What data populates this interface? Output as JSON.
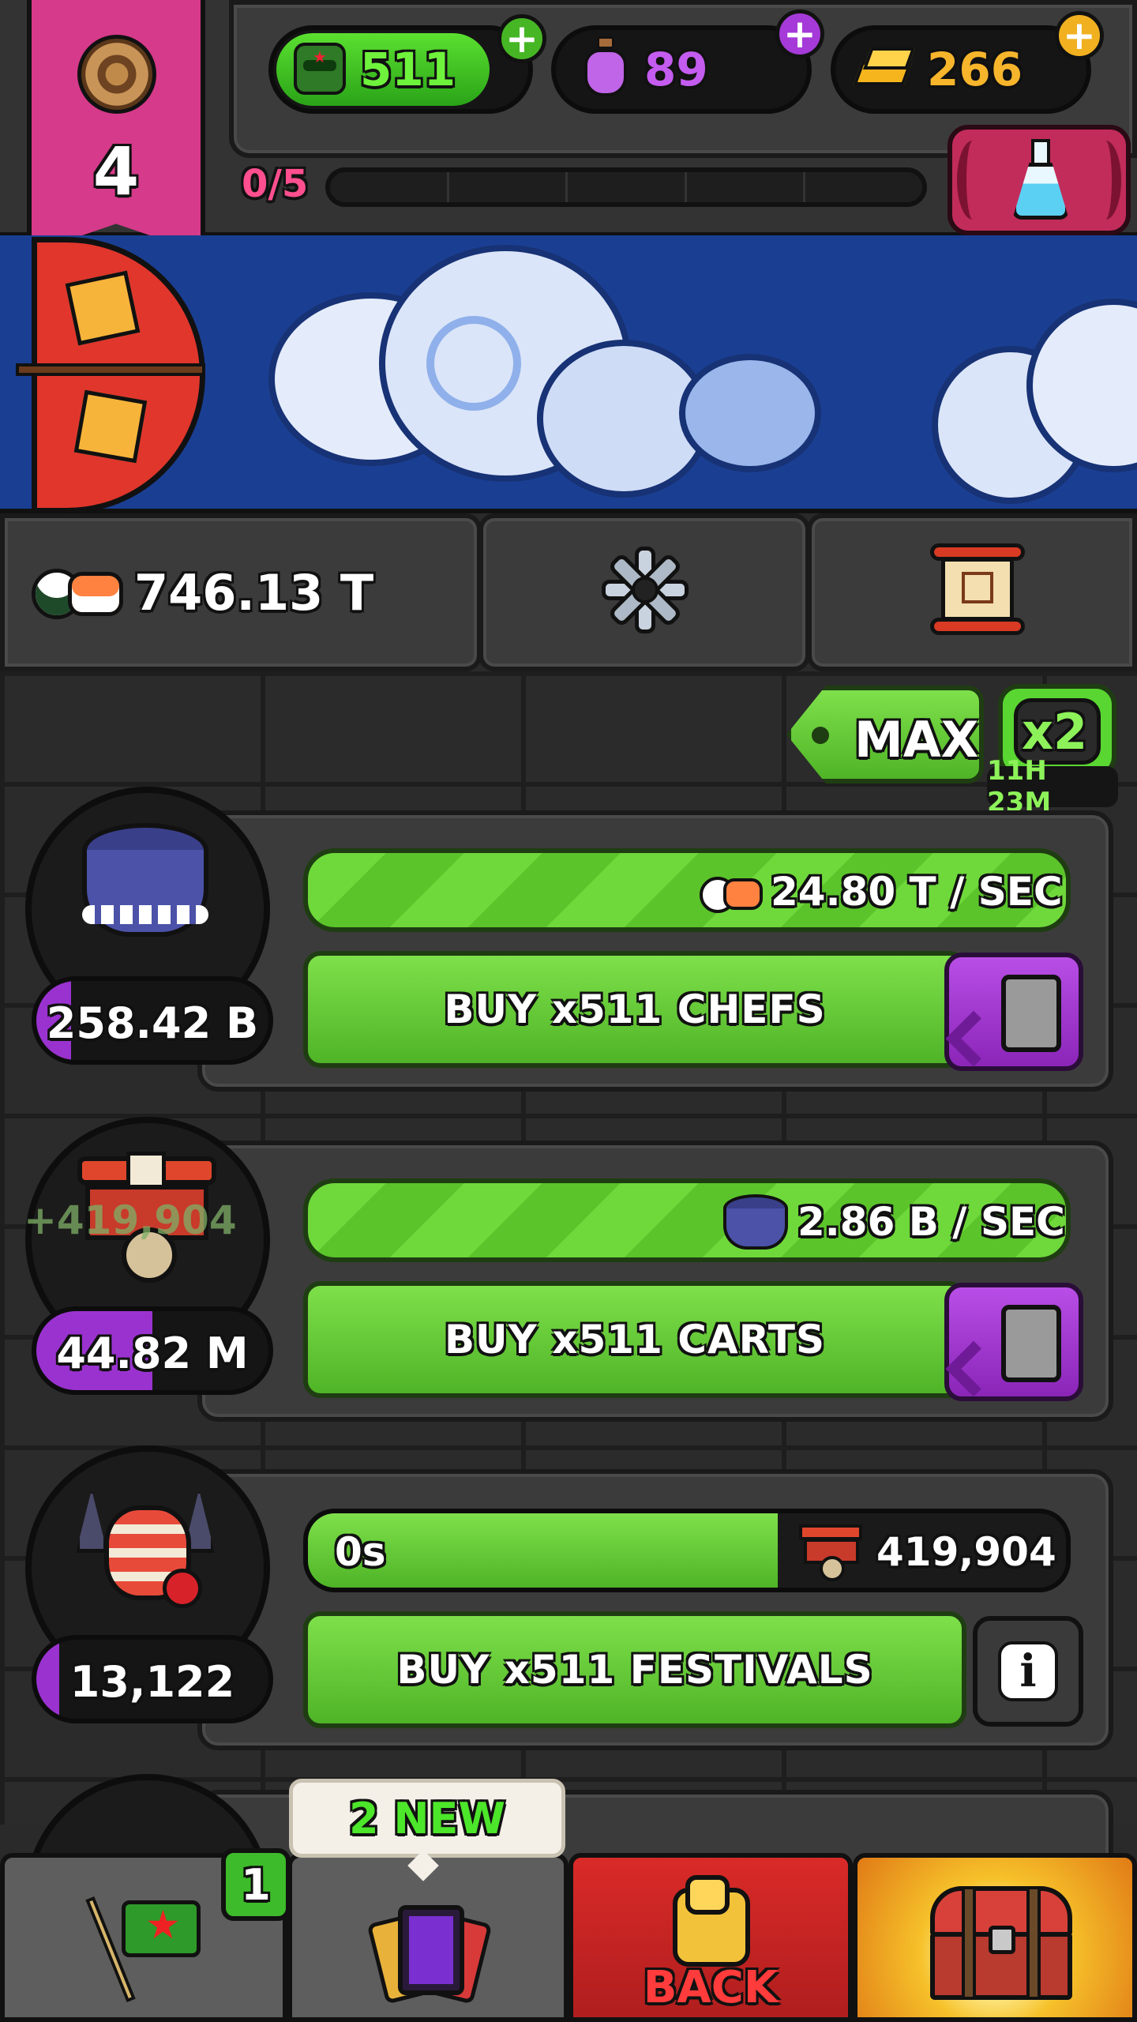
{
  "top": {
    "level": "4",
    "progress_text": "0/5",
    "progress_fraction": 0,
    "currencies": [
      {
        "name": "ninja",
        "value": "511",
        "color": "#4fcf2a"
      },
      {
        "name": "potion",
        "value": "89",
        "color": "#b24de0"
      },
      {
        "name": "gold",
        "value": "266",
        "color": "#f2b320"
      }
    ]
  },
  "stats": {
    "sushi_total": "746.13 T"
  },
  "multiplier": {
    "max_label": "MAX",
    "boost_label": "x2",
    "boost_timer": "11H 23M"
  },
  "rows": [
    {
      "rate": "24.80 T / SEC",
      "buy_label": "BUY x511 CHEFS",
      "cost": "258.42 B",
      "cost_fraction": 0.15
    },
    {
      "floating": "+419,904",
      "rate": "2.86 B / SEC",
      "buy_label": "BUY x511 CARTS",
      "cost": "44.82 M",
      "cost_fraction": 0.5
    },
    {
      "timer": "0s",
      "count": "419,904",
      "bar_fraction": 0.62,
      "buy_label": "BUY x511 FESTIVALS",
      "cost": "13,122",
      "cost_fraction": 0.1
    }
  ],
  "bottom": {
    "missions_badge": "1",
    "cards_new": "2 NEW",
    "back_label": "BACK"
  }
}
